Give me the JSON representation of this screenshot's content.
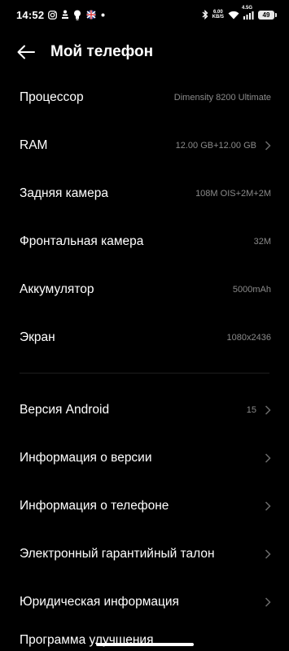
{
  "status_bar": {
    "time": "14:52",
    "icons_left": [
      "instagram-icon",
      "usb-debug-icon",
      "lightbulb-icon",
      "flag-icon",
      "dot-icon"
    ],
    "speed_top": "6.00",
    "speed_bottom": "KB/S",
    "network": "4.5G",
    "battery": "49"
  },
  "header": {
    "title": "Мой телефон"
  },
  "specs": [
    {
      "label": "Процессор",
      "value": "Dimensity 8200 Ultimate"
    },
    {
      "label": "RAM",
      "value": "12.00 GB+12.00 GB"
    },
    {
      "label": "Задняя камера",
      "value": "108M OIS+2M+2M"
    },
    {
      "label": "Фронтальная камера",
      "value": "32M"
    },
    {
      "label": "Аккумулятор",
      "value": "5000mAh"
    },
    {
      "label": "Экран",
      "value": "1080x2436"
    }
  ],
  "menu": [
    {
      "label": "Версия Android",
      "value": "15"
    },
    {
      "label": "Информация о версии",
      "value": ""
    },
    {
      "label": "Информация о телефоне",
      "value": ""
    },
    {
      "label": "Электронный гарантийный талон",
      "value": ""
    },
    {
      "label": "Юридическая информация",
      "value": ""
    }
  ],
  "partial_item": "Программа улучшения"
}
